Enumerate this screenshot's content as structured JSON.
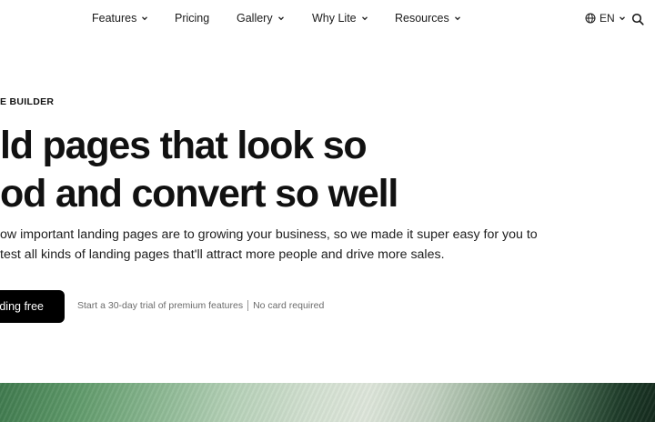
{
  "nav": {
    "items": [
      {
        "label": "Features",
        "dropdown": true
      },
      {
        "label": "Pricing",
        "dropdown": false
      },
      {
        "label": "Gallery",
        "dropdown": true
      },
      {
        "label": "Why Lite",
        "dropdown": true
      },
      {
        "label": "Resources",
        "dropdown": true
      }
    ],
    "language": "EN",
    "icons": {
      "language": "globe-icon",
      "search": "search-icon",
      "dropdown": "chevron-down-icon"
    }
  },
  "hero": {
    "eyebrow": "E BUILDER",
    "headline_line1": "ld pages that look so",
    "headline_line2": "od and convert so well",
    "subtext_line1": "ow important landing pages are to growing your business, so we made it super easy for you to",
    "subtext_line2": "test all kinds of landing pages that'll attract more people and drive more sales.",
    "cta_label": "ding free",
    "note_trial": "Start a 30-day trial of premium features",
    "note_card": "No card required"
  },
  "colors": {
    "text": "#111111",
    "cta_background": "#000000",
    "cta_text": "#ffffff",
    "muted_text": "#6b6b6b",
    "band_green_dark": "#142a1d",
    "band_green_light": "#dee6db"
  }
}
